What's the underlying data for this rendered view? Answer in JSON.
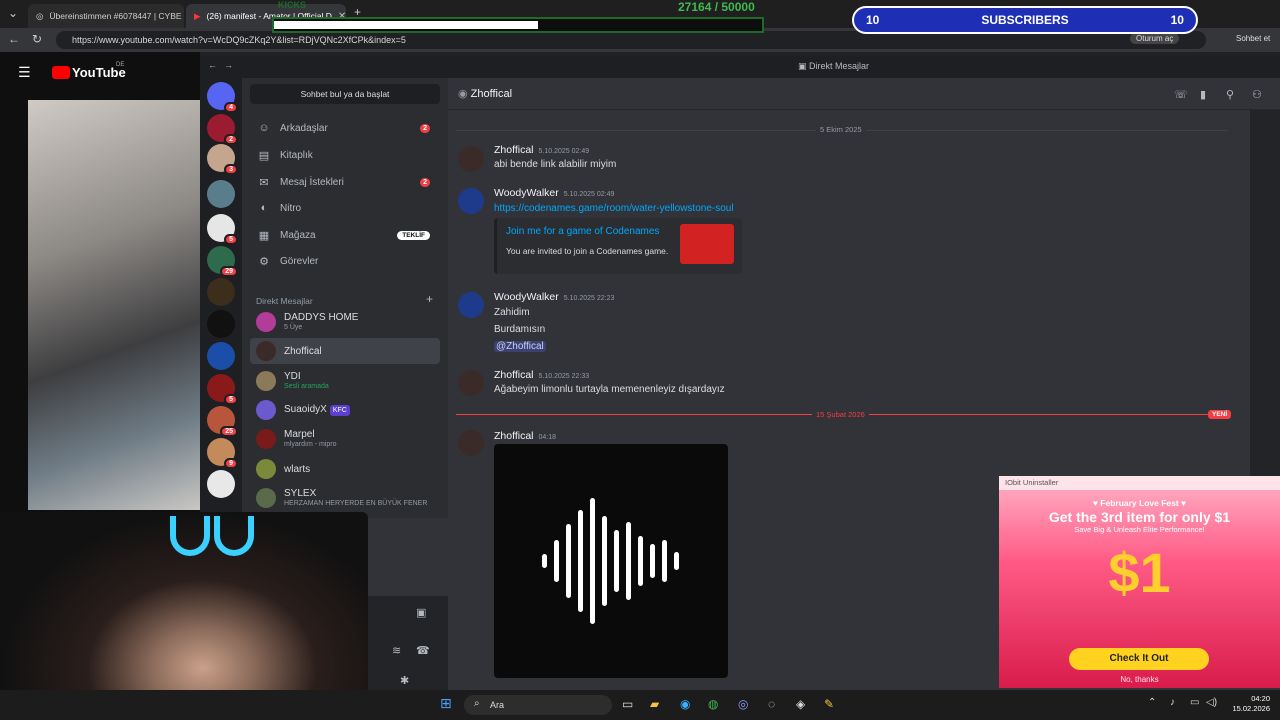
{
  "browser": {
    "tabs": [
      {
        "label": "Übereinstimmen #6078447 | CYBE"
      },
      {
        "label": "(26) manifest - Amator | Official D"
      }
    ],
    "url": "https://www.youtube.com/watch?v=WcDQ9cZKq2Y&list=RDjVQNc2XfCPk&index=5",
    "profile_button": "Oturum aç",
    "copilot_button": "Sohbet et"
  },
  "overlay": {
    "kicks_label": "KICKS",
    "kicks_count": "27164 / 50000",
    "kicks_progress": 0.54,
    "subs_left": "10",
    "subs_label": "SUBSCRIBERS",
    "subs_right": "10"
  },
  "youtube": {
    "logo": "YouTube",
    "region": "DE"
  },
  "discord": {
    "window_title": "Direkt Mesajlar",
    "search_placeholder": "Sohbet bul ya da başlat",
    "nav": [
      {
        "label": "Arkadaşlar",
        "badge": "2",
        "icon": "friends-icon"
      },
      {
        "label": "Kitaplık",
        "badge": "",
        "icon": "library-icon"
      },
      {
        "label": "Mesaj İstekleri",
        "badge": "2",
        "icon": "mail-icon"
      },
      {
        "label": "Nitro",
        "badge": "",
        "icon": "nitro-icon"
      },
      {
        "label": "Mağaza",
        "badge": "TEKLİF",
        "icon": "shop-icon"
      },
      {
        "label": "Görevler",
        "badge": "",
        "icon": "quests-icon"
      }
    ],
    "dm_header": "Direkt Mesajlar",
    "dms": [
      {
        "name": "DADDYS HOME",
        "sub": "5 Üye"
      },
      {
        "name": "Zhoffical",
        "sub": ""
      },
      {
        "name": "YDI",
        "sub": "Sesli aramada"
      },
      {
        "name": "SuaoidyX",
        "sub": "",
        "tag": "KFC"
      },
      {
        "name": "Marpel",
        "sub": "mlyardım - mipro"
      },
      {
        "name": "wlarts",
        "sub": ""
      },
      {
        "name": "SYLEX",
        "sub": "HERZAMAN HERYERDE EN BÜYÜK FENER"
      }
    ],
    "guild_badges": [
      "4",
      "2",
      "3",
      "",
      "5",
      "29",
      "",
      "",
      "",
      "5",
      "25",
      "9",
      ""
    ],
    "chat": {
      "title": "Zhoffical",
      "date1": "5 Ekim 2025",
      "date2": "15 Şubat 2026",
      "new_label": "YENİ",
      "messages": [
        {
          "author": "Zhoffical",
          "time": "5.10.2025 02:49",
          "lines": [
            "abi bende link alabilir miyim"
          ]
        },
        {
          "author": "WoodyWalker",
          "time": "5.10.2025 02:49",
          "lines": [
            "https://codenames.game/room/water-yellowstone-soul"
          ]
        },
        {
          "author": "WoodyWalker",
          "time": "5.10.2025 22:23",
          "lines": [
            "Zahidim",
            "Burdamısın",
            "@Zhoffical"
          ]
        },
        {
          "author": "Zhoffical",
          "time": "5.10.2025 22:33",
          "lines": [
            "Ağabeyim limonlu turtayla memenenleyiz dışardayız"
          ]
        },
        {
          "author": "Zhoffical",
          "time": "04:18",
          "lines": []
        }
      ],
      "embed_title": "Join me for a game of Codenames",
      "embed_desc": "You are invited to join a Codenames game."
    }
  },
  "ad": {
    "window_title": "IObit Uninstaller",
    "headline1": "♥ February Love Fest ♥",
    "headline2": "Get the 3rd item for only $1",
    "headline3": "Save Big & Unleash Elite Performance!",
    "price": "$1",
    "cta": "Check It Out",
    "dismiss": "No, thanks"
  },
  "taskbar": {
    "search": "Ara",
    "time": "04:20",
    "date": "15.02.2026"
  },
  "colors": {
    "discord_bg": "#313338",
    "link": "#00a8fc",
    "accent_red": "#f23f43",
    "subs_blue": "#1f2fb5"
  }
}
